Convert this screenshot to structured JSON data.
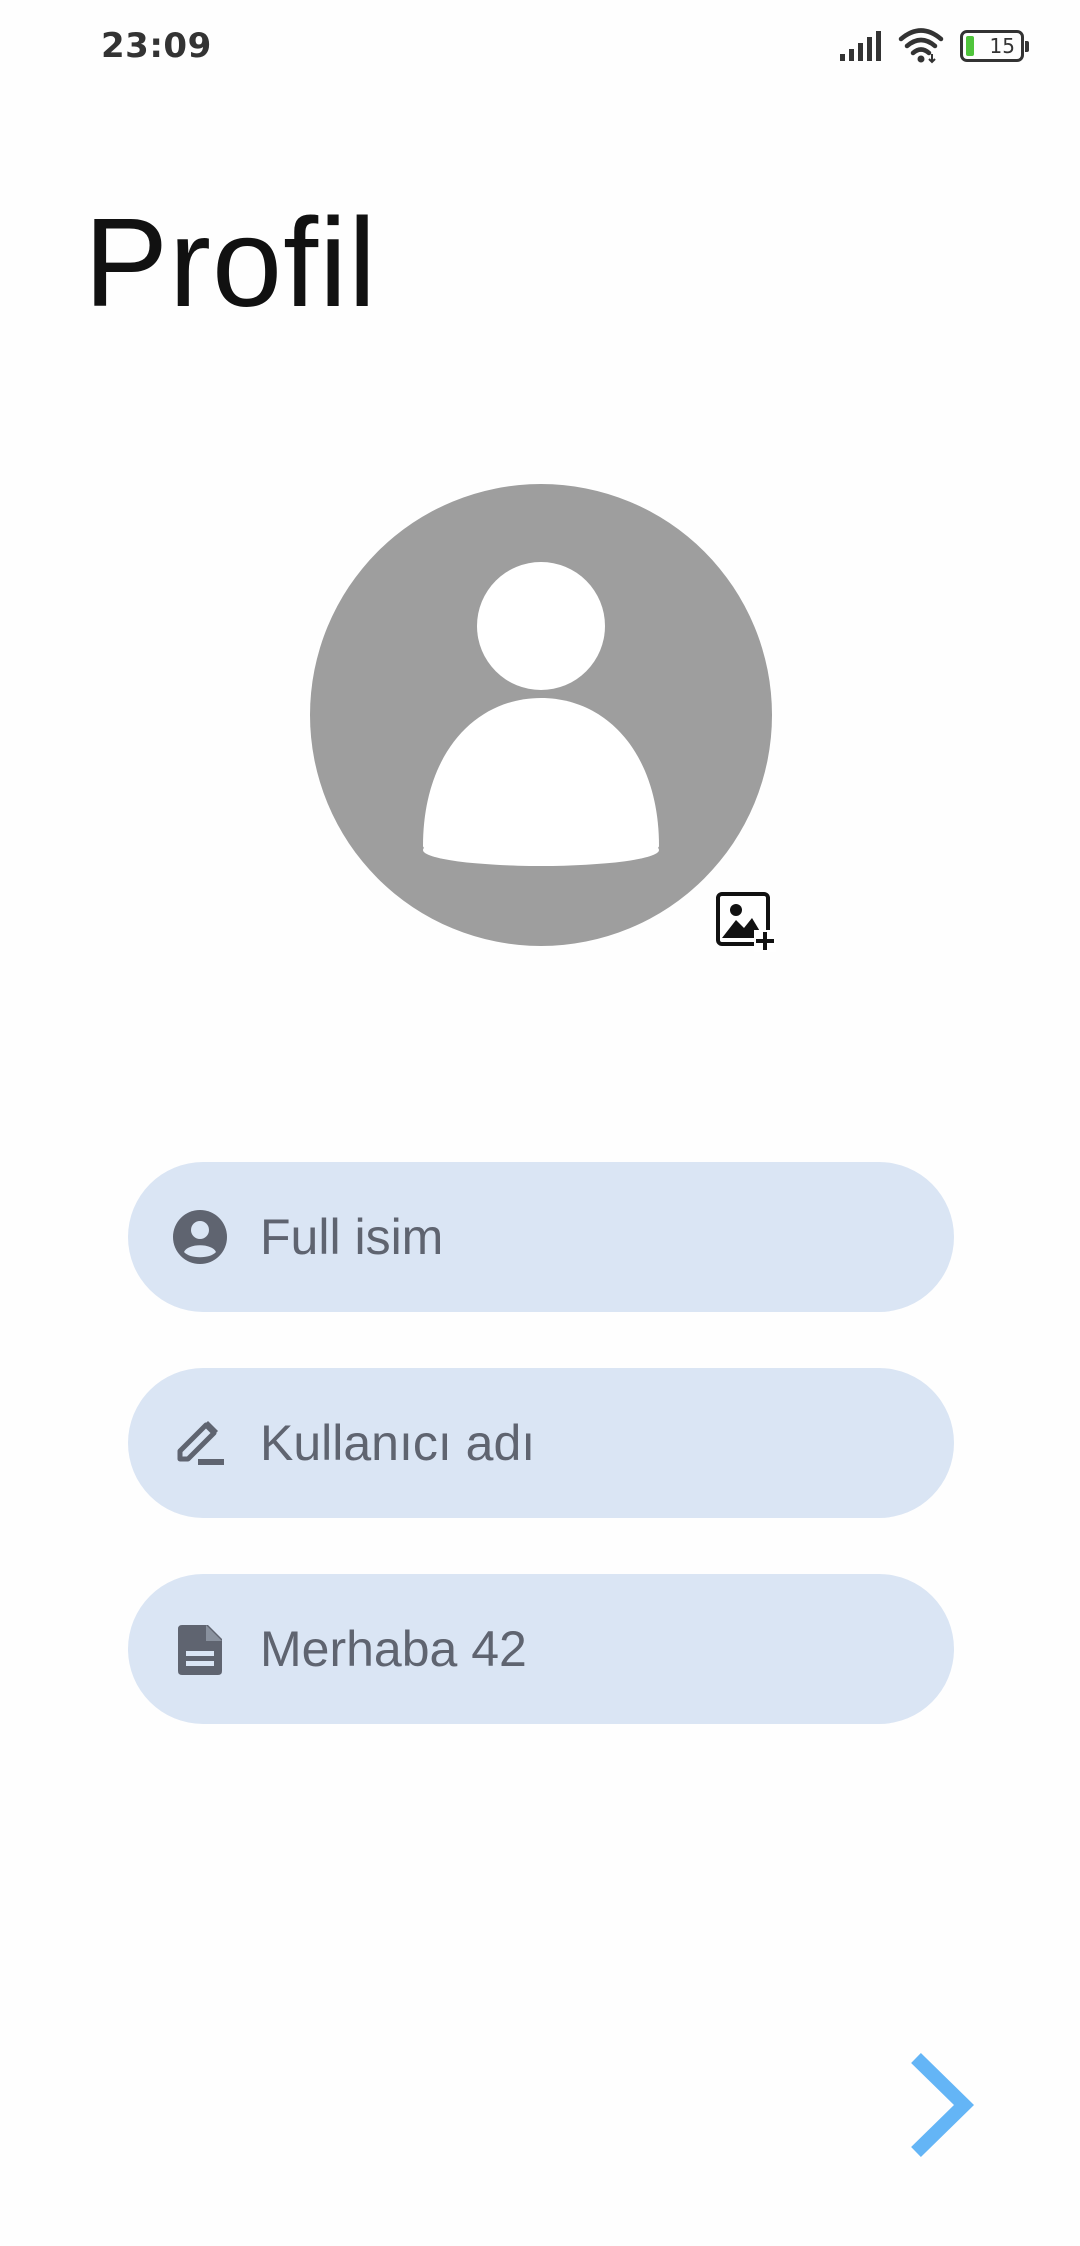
{
  "status_bar": {
    "time": "23:09",
    "battery_level": "15",
    "icons": [
      "signal-icon",
      "wifi-icon",
      "battery-icon"
    ]
  },
  "page": {
    "title": "Profil"
  },
  "avatar": {
    "icon": "person-icon",
    "add_photo_icon": "add-photo-icon"
  },
  "fields": [
    {
      "icon": "account-circle-icon",
      "value": "Full isim"
    },
    {
      "icon": "edit-icon",
      "value": "Kullanıcı adı"
    },
    {
      "icon": "description-icon",
      "value": "Merhaba 42"
    }
  ],
  "next_icon": "chevron-right-icon",
  "colors": {
    "field_background": "#dae5f4",
    "field_text": "#5f6470",
    "avatar_background": "#9e9e9e",
    "accent": "#64b5f6",
    "battery_green": "#4fc43b"
  }
}
